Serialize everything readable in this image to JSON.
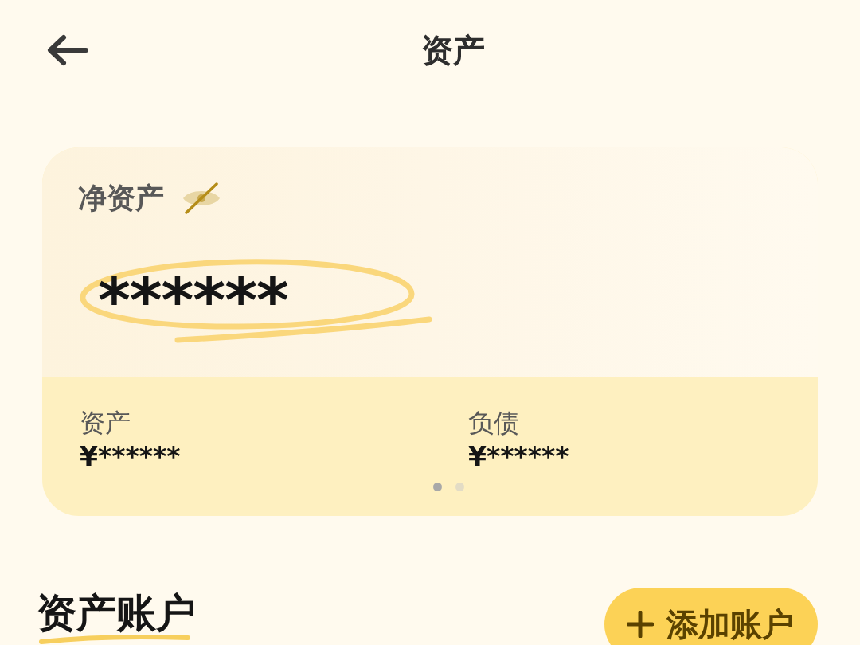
{
  "header": {
    "title": "资产"
  },
  "net_assets_card": {
    "label": "净资产",
    "hidden": true,
    "value": "******",
    "summary": [
      {
        "label": "资产",
        "value": "¥******"
      },
      {
        "label": "负债",
        "value": "¥******"
      }
    ],
    "pager": [
      {
        "selected": true
      },
      {
        "selected": false
      }
    ]
  },
  "accounts_section": {
    "title": "资产账户",
    "add_button": {
      "label": "添加账户"
    }
  }
}
